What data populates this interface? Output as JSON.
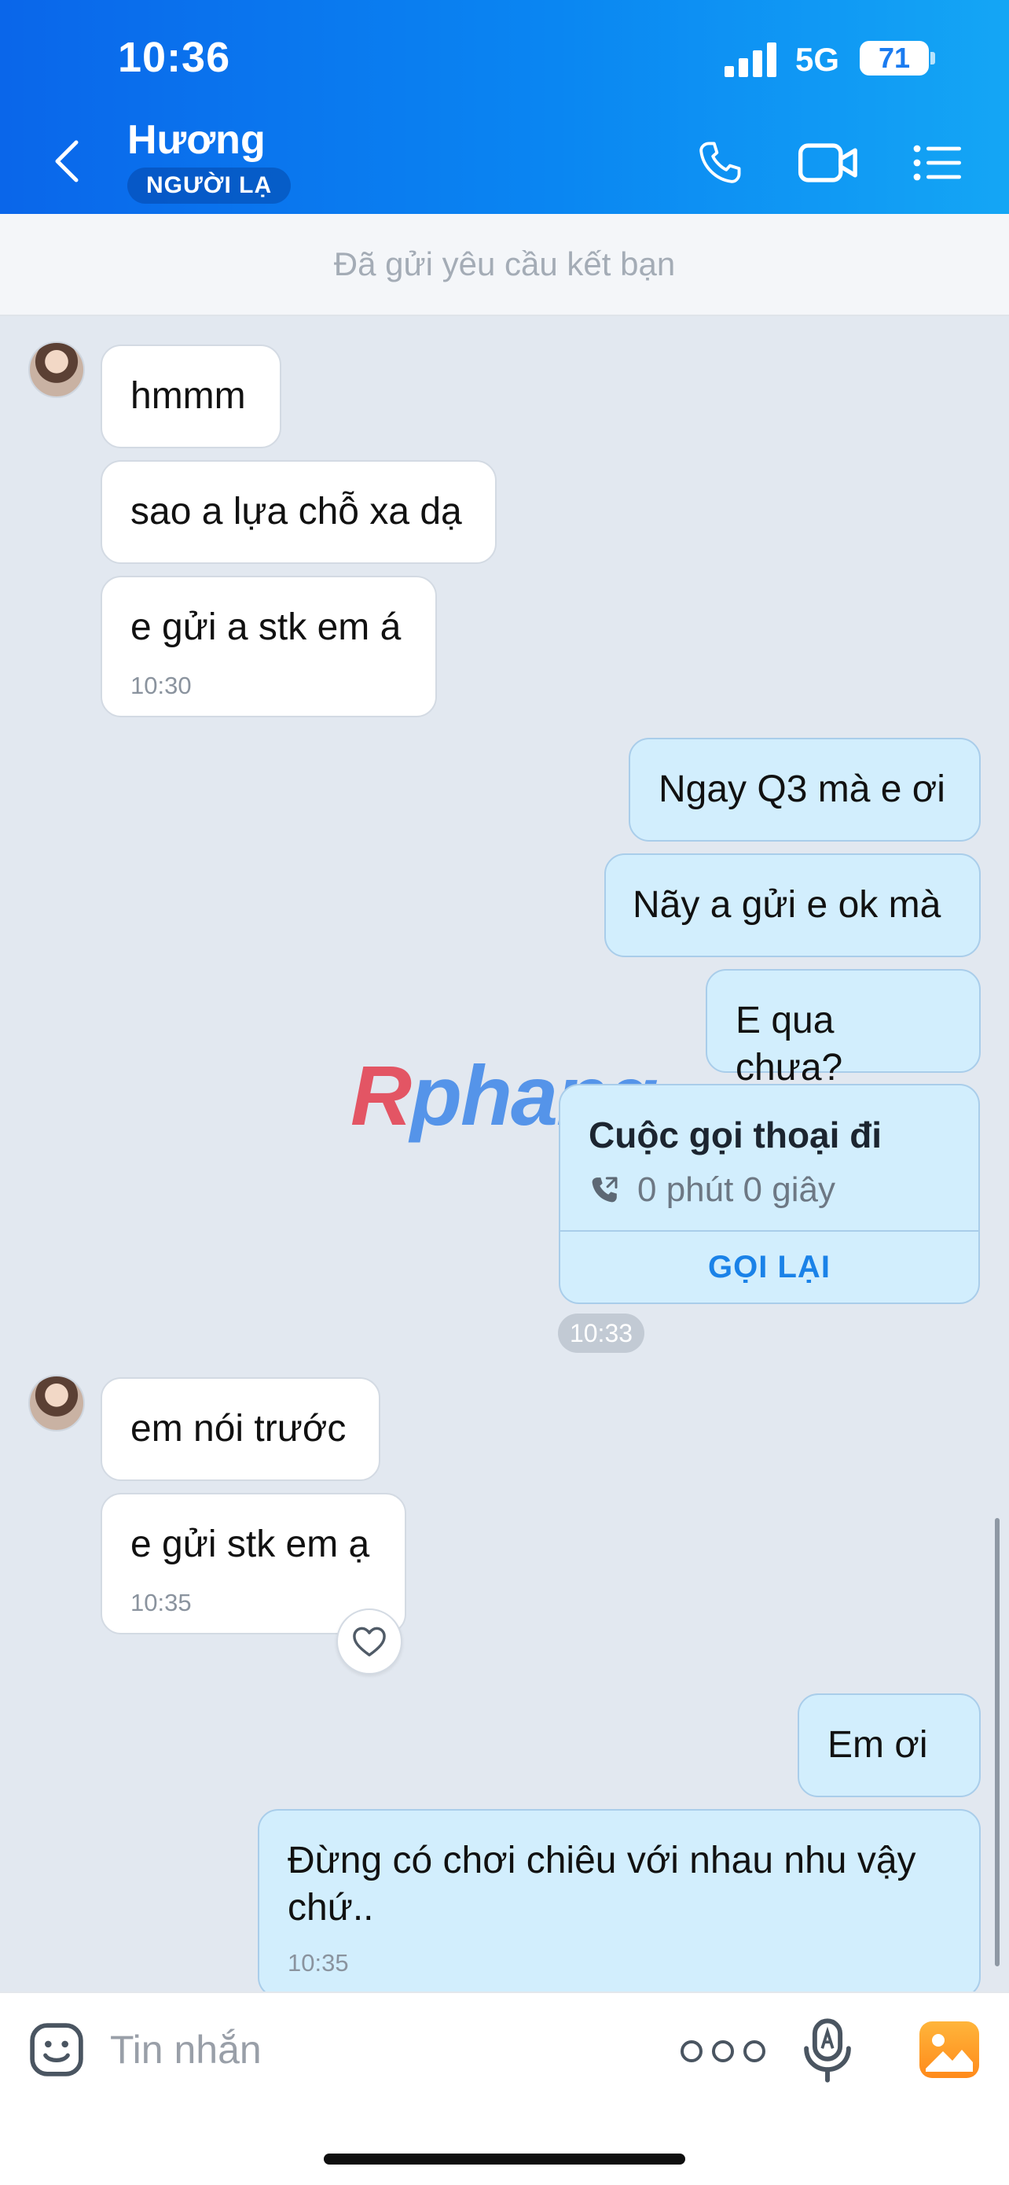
{
  "status_bar": {
    "time": "10:36",
    "network": "5G",
    "battery": "71"
  },
  "header": {
    "contact_name": "Hương",
    "badge": "NGƯỜI LẠ"
  },
  "banner": {
    "text": "Đã gửi yêu cầu kết bạn"
  },
  "messages": [
    {
      "text": "hmmm"
    },
    {
      "text": "sao a lựa chỗ xa dạ"
    },
    {
      "text": "e gửi a stk em á",
      "time": "10:30"
    },
    {
      "text": "Ngay Q3 mà e ơi"
    },
    {
      "text": "Nãy a gửi e ok mà"
    },
    {
      "text": "E qua chưa?"
    },
    {
      "text": "em nói trước"
    },
    {
      "text": "e gửi stk em ạ",
      "time": "10:35"
    },
    {
      "text": "Em ơi"
    },
    {
      "text": "Đừng có chơi chiêu với nhau nhu vậy chứ..",
      "time": "10:35"
    }
  ],
  "call_card": {
    "title": "Cuộc gọi thoại đi",
    "duration": "0 phút 0 giây",
    "action": "GỌI LẠI",
    "time": "10:33"
  },
  "watermark": {
    "first_letter": "R",
    "rest": "phang"
  },
  "input": {
    "placeholder": "Tin nhắn"
  },
  "colors": {
    "header_start": "#0a66ea",
    "header_end": "#14a6f5",
    "chat_bg": "#e2e8f0",
    "outgoing_bubble": "#d2eefd",
    "incoming_bubble": "#ffffff",
    "accent": "#1a82e8"
  }
}
